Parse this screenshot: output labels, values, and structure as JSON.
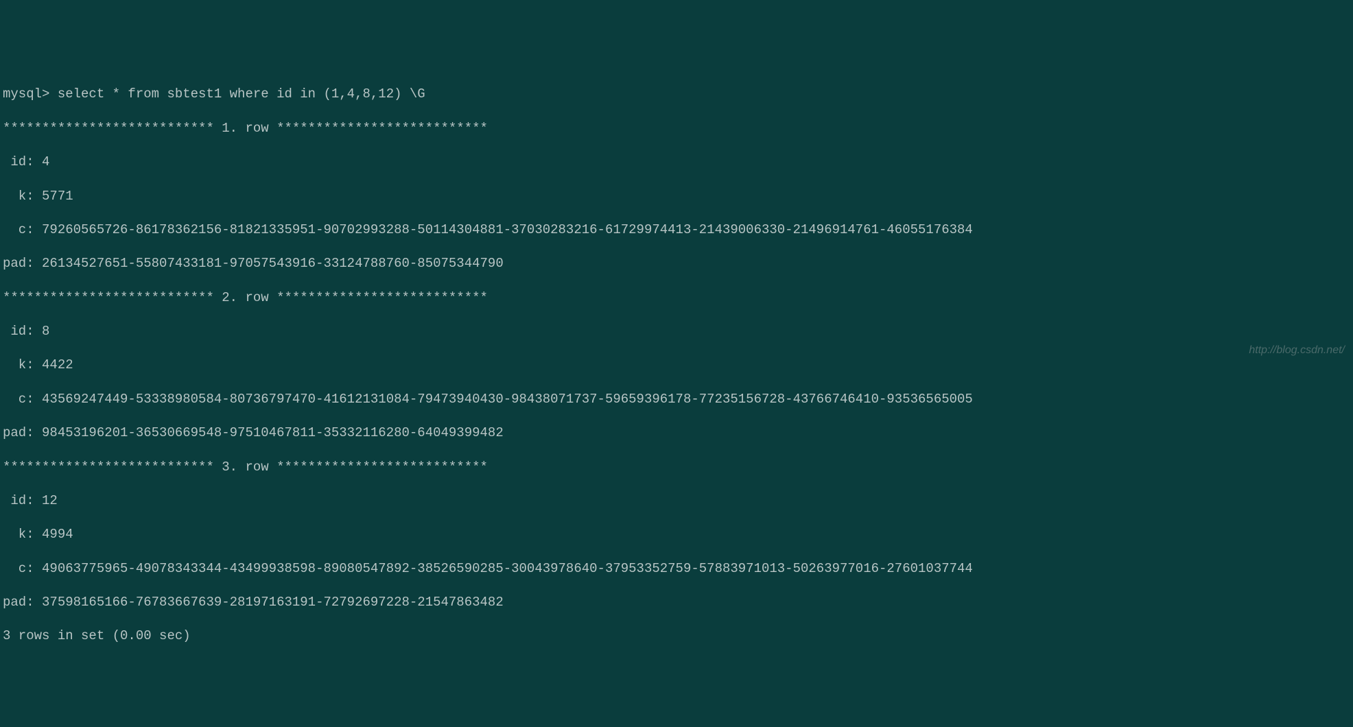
{
  "terminal": {
    "prompt_line": "mysql> select * from sbtest1 where id in (1,4,8,12) \\G",
    "row1_header": "*************************** 1. row ***************************",
    "row1_id": " id: 4",
    "row1_k": "  k: 5771",
    "row1_c": "  c: 79260565726-86178362156-81821335951-90702993288-50114304881-37030283216-61729974413-21439006330-21496914761-46055176384",
    "row1_pad": "pad: 26134527651-55807433181-97057543916-33124788760-85075344790",
    "row2_header": "*************************** 2. row ***************************",
    "row2_id": " id: 8",
    "row2_k": "  k: 4422",
    "row2_c": "  c: 43569247449-53338980584-80736797470-41612131084-79473940430-98438071737-59659396178-77235156728-43766746410-93536565005",
    "row2_pad": "pad: 98453196201-36530669548-97510467811-35332116280-64049399482",
    "row3_header": "*************************** 3. row ***************************",
    "row3_id": " id: 12",
    "row3_k": "  k: 4994",
    "row3_c": "  c: 49063775965-49078343344-43499938598-89080547892-38526590285-30043978640-37953352759-57883971013-50263977016-27601037744",
    "row3_pad": "pad: 37598165166-76783667639-28197163191-72792697228-21547863482",
    "footer": "3 rows in set (0.00 sec)"
  },
  "watermark": "http://blog.csdn.net/"
}
